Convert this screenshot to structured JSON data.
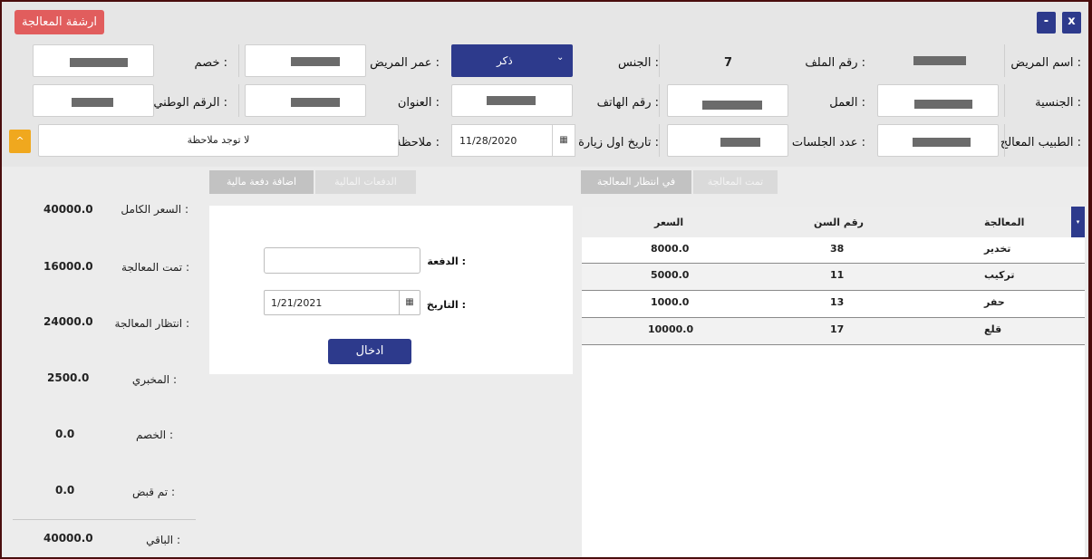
{
  "window": {
    "archive_label": "ارشفة المعالجة",
    "close_label": "x",
    "minimize_label": "-"
  },
  "patient": {
    "name_label": "اسم المريض :",
    "file_label": "رقم الملف :",
    "file_value": "7",
    "gender_label": "الجنس :",
    "gender_value": "ذكر",
    "age_label": "عمر المريض :",
    "discount_label": "خصم :",
    "nationality_label": "الجنسية :",
    "job_label": "العمل :",
    "phone_label": "رقم الهاتف :",
    "address_label": "العنوان :",
    "national_id_label": "الرقم الوطني :",
    "doctor_label": "الطبيب المعالج :",
    "sessions_label": "عدد الجلسات :",
    "first_visit_label": "تاريخ اول زيارة :",
    "first_visit_value": "11/28/2020",
    "note_label": "ملاحظة :",
    "note_value": "لا توجد ملاحظة"
  },
  "treatment_tabs": [
    {
      "label": "تمت المعالجة",
      "active": false
    },
    {
      "label": "في انتظار المعالجة",
      "active": true
    }
  ],
  "treatment_table": {
    "headers": [
      "المعالجة",
      "رقم السن",
      "السعر"
    ],
    "rows": [
      {
        "treatment": "تخدير",
        "tooth": "38",
        "price": "8000.0"
      },
      {
        "treatment": "تركيب",
        "tooth": "11",
        "price": "5000.0"
      },
      {
        "treatment": "حفر",
        "tooth": "13",
        "price": "1000.0"
      },
      {
        "treatment": "قلع",
        "tooth": "17",
        "price": "10000.0"
      }
    ]
  },
  "payment_tabs": [
    {
      "label": "الدفعات المالية",
      "active": false
    },
    {
      "label": "اضافة دفعة مالية",
      "active": true
    }
  ],
  "payment_form": {
    "amount_label": "الدفعة :",
    "amount_value": "",
    "date_label": "التاريخ :",
    "date_value": "1/21/2021",
    "submit_label": "ادخال"
  },
  "summary": [
    {
      "label": "السعر الكامل :",
      "value": "40000.0"
    },
    {
      "label": "تمت المعالجة :",
      "value": "16000.0"
    },
    {
      "label": "انتظار المعالجة :",
      "value": "24000.0"
    },
    {
      "label": "المخبري :",
      "value": "2500.0"
    },
    {
      "label": "الخصم :",
      "value": "0.0"
    },
    {
      "label": "تم قبض :",
      "value": "0.0"
    },
    {
      "label": "الباقي :",
      "value": "40000.0"
    }
  ],
  "colors": {
    "primary": "#2d3a8c",
    "archive": "#e15d5d",
    "warning": "#f0a81e"
  }
}
